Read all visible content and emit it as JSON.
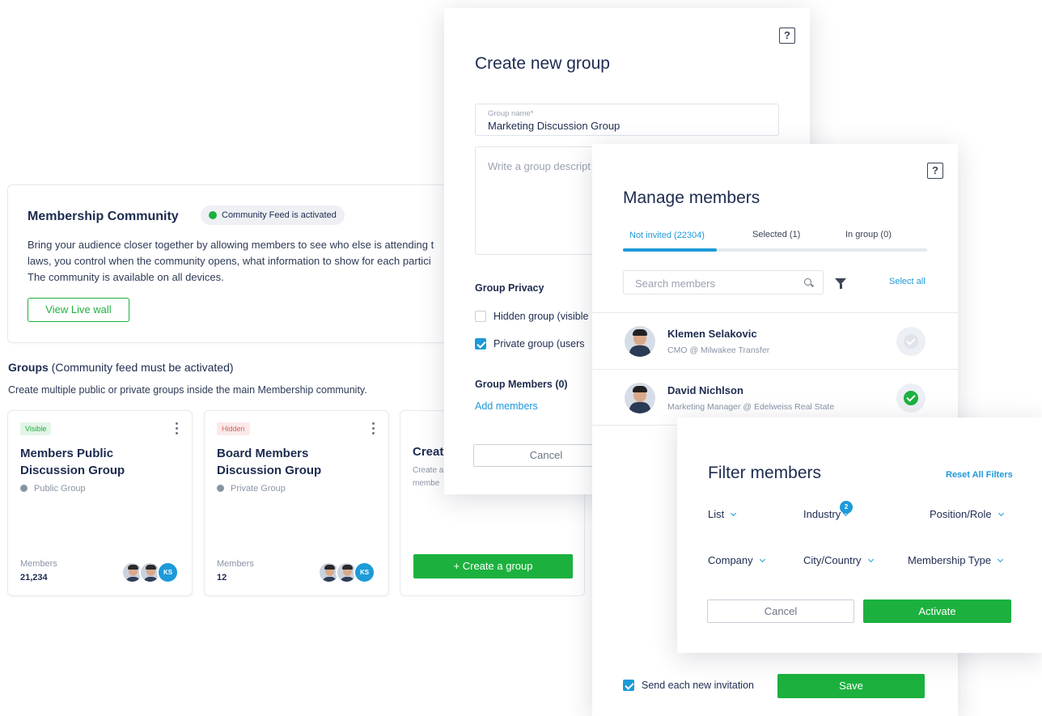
{
  "community": {
    "title": "Membership Community",
    "feed_status": "Community Feed is activated",
    "description_lines": [
      "Bring your audience closer together by allowing members to see who else is attending t",
      "laws, you control when the community opens, what information to show for each partici",
      "The community is available on all devices."
    ],
    "view_live_wall": "View Live wall"
  },
  "groups": {
    "heading_bold": "Groups",
    "heading_rest": " (Community feed must be activated)",
    "subtitle": "Create multiple public or private groups inside the main Membership community.",
    "members_label": "Members",
    "cards": [
      {
        "badge": "Visible",
        "title": "Members Public Discussion Group",
        "type": "Public Group",
        "members_count": "21,234",
        "avatar_initials": "KS"
      },
      {
        "badge": "Hidden",
        "title": "Board Members Discussion Group",
        "type": "Private Group",
        "members_count": "12",
        "avatar_initials": "KS"
      }
    ],
    "create_card": {
      "title": "Creat",
      "desc": "Create a\nmembe",
      "button": "+ Create a group"
    }
  },
  "create_group": {
    "help": "?",
    "title": "Create new group",
    "name_label": "Group name*",
    "name_value": "Marketing Discussion Group",
    "description_placeholder": "Write a group descript",
    "privacy_heading": "Group Privacy",
    "privacy_options": [
      {
        "label": "Hidden group (visible",
        "checked": false
      },
      {
        "label": "Private group (users",
        "checked": true
      }
    ],
    "members_heading": "Group Members (0)",
    "add_members": "Add members",
    "cancel": "Cancel"
  },
  "manage_members": {
    "help": "?",
    "title": "Manage members",
    "tabs": [
      {
        "label": "Not invited (22304)",
        "active": true
      },
      {
        "label": "Selected (1)",
        "active": false
      },
      {
        "label": "In group (0)",
        "active": false
      }
    ],
    "search_placeholder": "Search members",
    "select_all": "Select all",
    "members": [
      {
        "name": "Klemen Selakovic",
        "role": "CMO @ Milwakee Transfer",
        "selected": false
      },
      {
        "name": "David Nichlson",
        "role": "Marketing Manager @ Edelweiss Real State",
        "selected": true
      }
    ],
    "send_invitation": "Send each new invitation",
    "save": "Save"
  },
  "filter_members": {
    "title": "Filter members",
    "reset": "Reset All Filters",
    "filters_row1": [
      "List",
      "Industry",
      "Position/Role"
    ],
    "filters_row2": [
      "Company",
      "City/Country",
      "Membership Type"
    ],
    "industry_count": "2",
    "cancel": "Cancel",
    "activate": "Activate"
  },
  "colors": {
    "green": "#1cb13e",
    "blue": "#1d9ad8",
    "navy": "#1d2b4f",
    "hidden_red": "#d2605c"
  }
}
